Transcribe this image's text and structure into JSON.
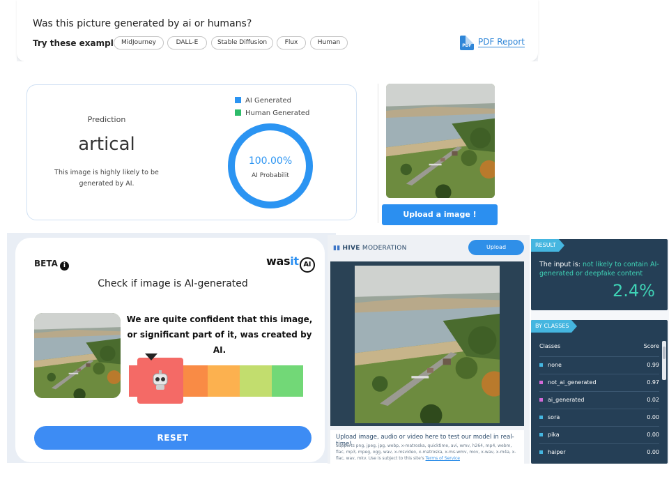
{
  "panel1": {
    "title": "Was this picture generated by ai or humans?",
    "try_label": "Try these examples:",
    "chips": [
      "MidJourney",
      "DALL-E",
      "Stable Diffusion",
      "Flux",
      "Human"
    ],
    "pdf_link": "PDF Report",
    "pdf_icon_text": "PDF",
    "prediction_label": "Prediction",
    "prediction_value": "artical",
    "prediction_desc": "This image is highly likely to be generated by AI.",
    "legend": [
      {
        "label": "AI Generated",
        "color": "#2b94f2"
      },
      {
        "label": "Human Generated",
        "color": "#2dbb6a"
      }
    ],
    "ring_value": "100.00%",
    "ring_label": "AI Probabilit",
    "upload_button": "Upload a image !"
  },
  "panel2": {
    "beta": "BETA",
    "info_icon": "i",
    "logo_prefix": "was",
    "logo_it": "it",
    "logo_ai": "AI",
    "heading": "Check if image is AI-generated",
    "message": "We are quite confident that this image, or significant part of it, was created by AI.",
    "robot_icon": "robot-icon",
    "meter_colors": [
      "#f46a66",
      "#f98b45",
      "#fcb14f",
      "#c2dd6e",
      "#72d877"
    ],
    "reset_button": "RESET"
  },
  "panel3": {
    "logo_hive": "HIVE",
    "logo_rest": "MODERATION",
    "upload_button": "Upload",
    "footer_title": "Upload image, audio or video here to test our model in real-time!",
    "footer_text": "Supports png, jpeg, jpg, webp, x-matroska, quicktime, avi, wmv, h264, mp4, webm, flac, mp3, mpeg, ogg, wav, x-msvideo, x-matroska, x-ms-wmv, mov, x-wav, x-m4a, x-flac, wav, mkv. Use is subject to this site's",
    "terms_link": "Terms of Service"
  },
  "panel4": {
    "result_tag": "RESULT",
    "input_prefix": "The input is: ",
    "input_verdict": "not likely to contain AI-generated or deepfake content",
    "percentage": "2.4%",
    "classes_tag": "BY CLASSES",
    "col_classes": "Classes",
    "col_score": "Score",
    "rows": [
      {
        "name": "none",
        "score": "0.99",
        "color": "#45b6e0"
      },
      {
        "name": "not_ai_generated",
        "score": "0.97",
        "color": "#d36ad8"
      },
      {
        "name": "ai_generated",
        "score": "0.02",
        "color": "#d36ad8"
      },
      {
        "name": "sora",
        "score": "0.00",
        "color": "#45b6e0"
      },
      {
        "name": "pika",
        "score": "0.00",
        "color": "#45b6e0"
      },
      {
        "name": "haiper",
        "score": "0.00",
        "color": "#45b6e0"
      }
    ]
  }
}
